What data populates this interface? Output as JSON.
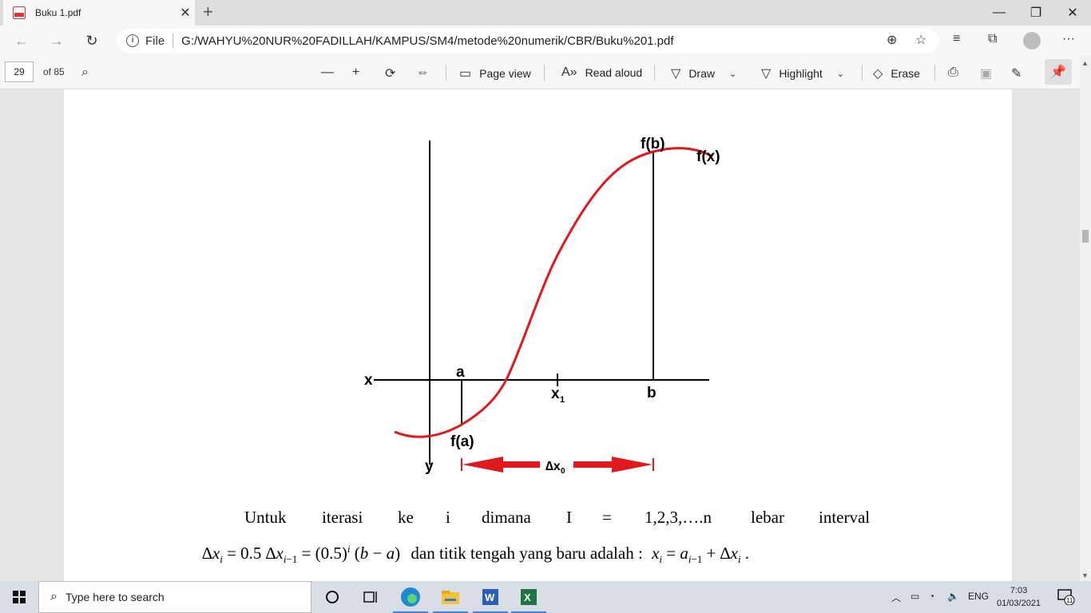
{
  "tab": {
    "title": "Buku 1.pdf",
    "close": "✕",
    "new_tab": "+"
  },
  "window": {
    "minimize": "—",
    "restore": "❐",
    "close": "✕"
  },
  "address": {
    "scheme_label": "File",
    "url": "G:/WAHYU%20NUR%20FADILLAH/KAMPUS/SM4/metode%20numerik/CBR/Buku%201.pdf"
  },
  "pdf_toolbar": {
    "page_number": "29",
    "page_total": "of 85",
    "page_view": "Page view",
    "read_aloud": "Read aloud",
    "draw": "Draw",
    "highlight": "Highlight",
    "erase": "Erase"
  },
  "figure": {
    "label_fb": "f(b)",
    "label_fx": "f(x)",
    "label_x_axis": "x",
    "label_a": "a",
    "label_x1": "x",
    "label_x1_sub": "1",
    "label_b": "b",
    "label_fa": "f(a)",
    "label_y": "y",
    "label_dx": "∆x",
    "label_dx_sub": "0",
    "curve_color": "#e0191d"
  },
  "text": {
    "line1_words": [
      "Untuk",
      "iterasi",
      "ke",
      "i",
      "dimana",
      "I",
      "=",
      "1,2,3,….n",
      "lebar",
      "interval"
    ],
    "line2_middle": "dan titik tengah yang baru adalah :"
  },
  "taskbar": {
    "search_placeholder": "Type here to search",
    "lang": "ENG",
    "time": "7:03",
    "date": "01/03/2021",
    "notifications": "11"
  }
}
